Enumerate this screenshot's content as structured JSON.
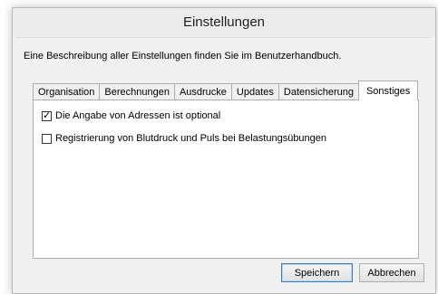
{
  "window": {
    "title": "Einstellungen"
  },
  "description": "Eine Beschreibung aller Einstellungen finden Sie im Benutzerhandbuch.",
  "tabs": [
    {
      "label": "Organisation",
      "active": false
    },
    {
      "label": "Berechnungen",
      "active": false
    },
    {
      "label": "Ausdrucke",
      "active": false
    },
    {
      "label": "Updates",
      "active": false
    },
    {
      "label": "Datensicherung",
      "active": false
    },
    {
      "label": "Sonstiges",
      "active": true
    }
  ],
  "options": [
    {
      "label": "Die Angabe von Adressen ist optional",
      "checked": true
    },
    {
      "label": "Registrierung von Blutdruck und Puls bei Belastungsübungen",
      "checked": false
    }
  ],
  "buttons": {
    "save_label": "Speichern",
    "cancel_label": "Abbrechen"
  },
  "colors": {
    "window_background": "#f0f0f0",
    "panel_background": "#ffffff",
    "border": "#adadad",
    "default_button_border": "#3c7fb1"
  },
  "icons": {
    "checkmark": "✓"
  }
}
